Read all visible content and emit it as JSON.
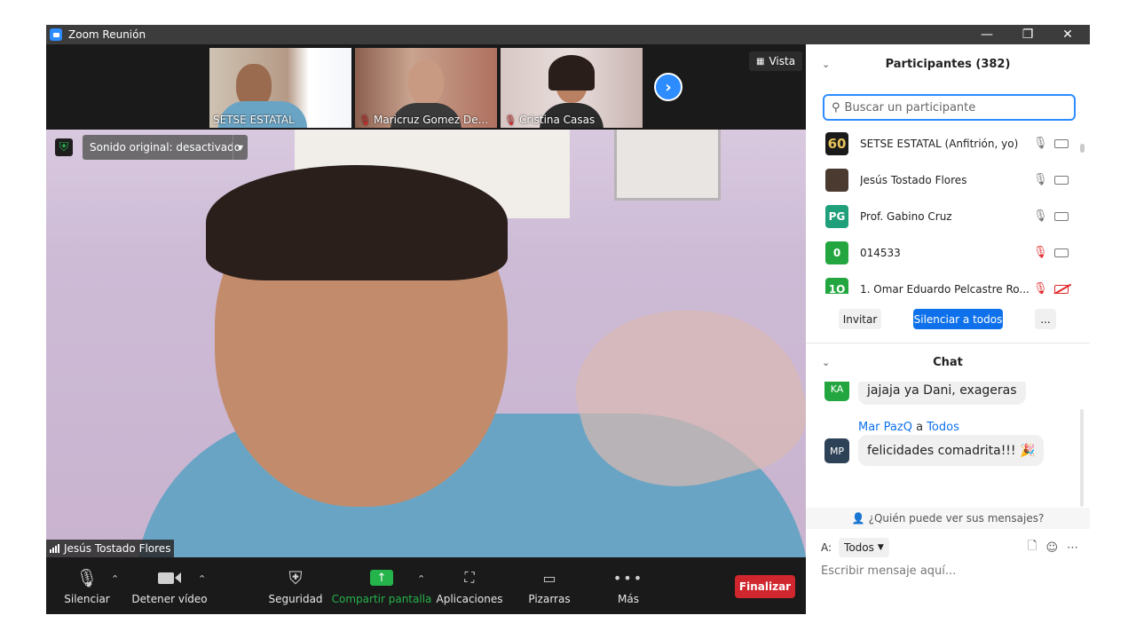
{
  "window": {
    "title": "Zoom Reunión",
    "controls": {
      "minimize": "—",
      "restore": "❐",
      "close": "✕"
    }
  },
  "thumbnails": [
    {
      "name": "SETSE ESTATAL",
      "muted": false
    },
    {
      "name": "Maricruz Gomez De...",
      "muted": true
    },
    {
      "name": "Cristina Casas",
      "muted": true
    }
  ],
  "view_button": {
    "icon": "grid-icon",
    "label": "Vista"
  },
  "main_video": {
    "sound_label": "Sonido original: desactivado",
    "speaker_name": "Jesús Tostado Flores"
  },
  "toolbar": {
    "mute": "Silenciar",
    "stop_video": "Detener vídeo",
    "security": "Seguridad",
    "share": "Compartir pantalla",
    "apps": "Aplicaciones",
    "whiteboards": "Pizarras",
    "more": "Más",
    "end": "Finalizar"
  },
  "participants": {
    "title": "Participantes (382)",
    "search_placeholder": "Buscar un participante",
    "list": [
      {
        "avatar": "60",
        "name": "SETSE ESTATAL (Anfitrión, yo)",
        "mic_off": false,
        "cam_off": false,
        "color": "#1a1a1a"
      },
      {
        "avatar": "",
        "name": "Jesús Tostado Flores",
        "mic_off": false,
        "cam_off": false,
        "color": "#4a3a30"
      },
      {
        "avatar": "PG",
        "name": "Prof. Gabino Cruz",
        "mic_off": false,
        "cam_off": false,
        "color": "#1f9f7a"
      },
      {
        "avatar": "0",
        "name": "014533",
        "mic_off": true,
        "cam_off": false,
        "color": "#23a63f"
      },
      {
        "avatar": "1O",
        "name": "1. Omar Eduardo Pelcastre Ro...",
        "mic_off": true,
        "cam_off": true,
        "color": "#23a63f"
      }
    ],
    "invite": "Invitar",
    "mute_all": "Silenciar a todos",
    "more": "..."
  },
  "chat": {
    "title": "Chat",
    "messages": [
      {
        "avatar": "KA",
        "avatar_color": "#23a63f",
        "text": "jajaja ya Dani, exageras"
      },
      {
        "avatar": "MP",
        "avatar_color": "#2e4257",
        "sender": "Mar PazQ",
        "connector": "a",
        "recipient": "Todos",
        "text": "felicidades comadrita!!! 🎉"
      }
    ],
    "who_can_see": "¿Quién puede ver sus mensajes?",
    "to_label": "A:",
    "to_value": "Todos",
    "input_placeholder": "Escribir mensaje aquí..."
  }
}
